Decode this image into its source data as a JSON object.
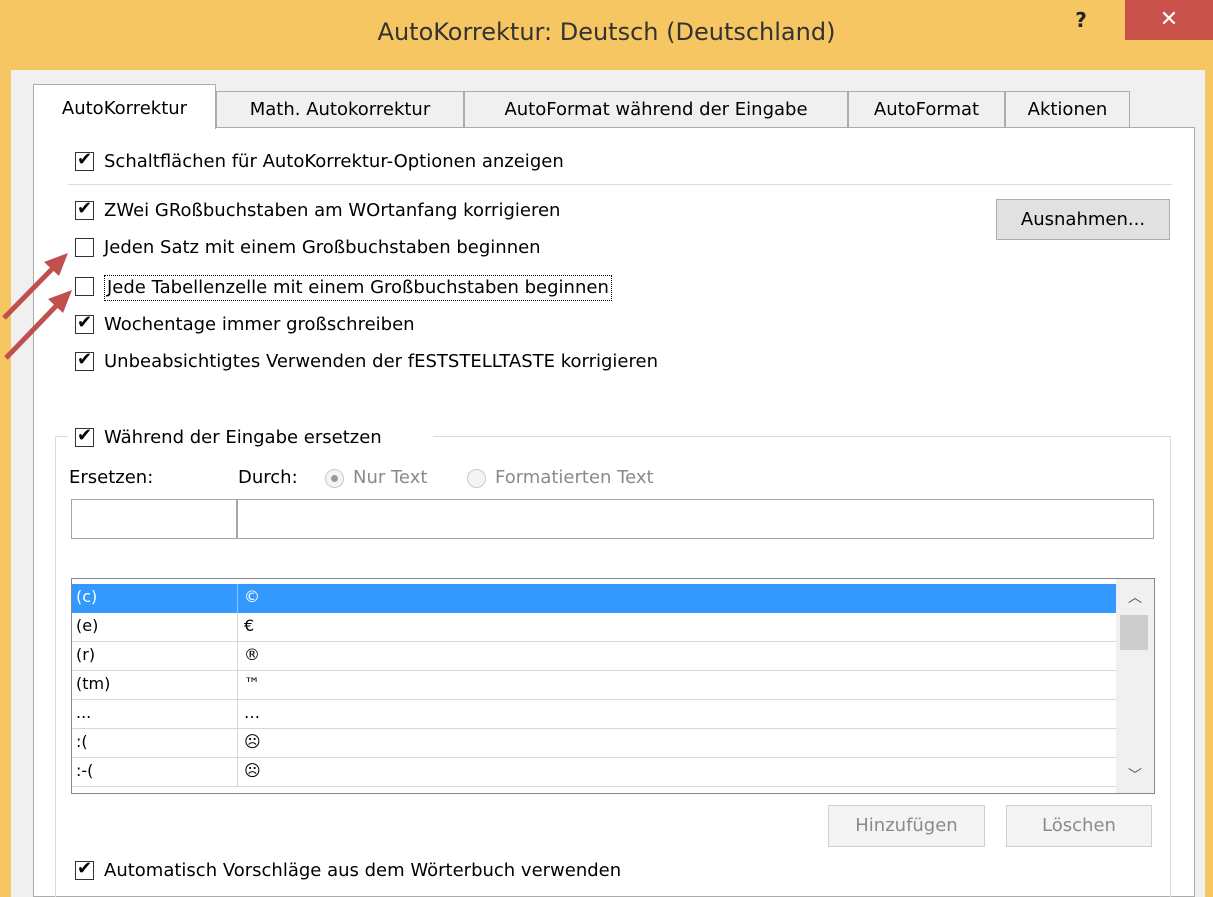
{
  "window": {
    "title": "AutoKorrektur: Deutsch (Deutschland)",
    "help_label": "?",
    "close_label": "✕"
  },
  "tabs": [
    {
      "label": "AutoKorrektur",
      "active": true
    },
    {
      "label": "Math. Autokorrektur",
      "active": false
    },
    {
      "label": "AutoFormat während der Eingabe",
      "active": false
    },
    {
      "label": "AutoFormat",
      "active": false
    },
    {
      "label": "Aktionen",
      "active": false
    }
  ],
  "options": {
    "show_buttons": {
      "checked": true,
      "label": "Schaltflächen für AutoKorrektur-Optionen anzeigen"
    },
    "two_initial_caps": {
      "checked": true,
      "label": "ZWei GRoßbuchstaben am WOrtanfang korrigieren"
    },
    "capitalize_sentences": {
      "checked": false,
      "label": "Jeden Satz mit einem Großbuchstaben beginnen"
    },
    "capitalize_table_cells": {
      "checked": false,
      "label": "Jede Tabellenzelle mit einem Großbuchstaben beginnen"
    },
    "capitalize_weekdays": {
      "checked": true,
      "label": "Wochentage immer großschreiben"
    },
    "caps_lock_fix": {
      "checked": true,
      "label": "Unbeabsichtigtes Verwenden der fESTSTELLTASTE korrigieren"
    }
  },
  "exceptions_button": "Ausnahmen...",
  "replace_group": {
    "checked": true,
    "label": "Während der Eingabe ersetzen",
    "replace_label": "Ersetzen:",
    "with_label": "Durch:",
    "radio_plain": {
      "label": "Nur Text",
      "selected": true
    },
    "radio_formatted": {
      "label": "Formatierten Text",
      "selected": false
    },
    "replace_value": "",
    "with_value": ""
  },
  "entries": [
    {
      "replace": "(c)",
      "with": "©",
      "selected": true
    },
    {
      "replace": "(e)",
      "with": "€",
      "selected": false
    },
    {
      "replace": "(r)",
      "with": "®",
      "selected": false
    },
    {
      "replace": "(tm)",
      "with": "™",
      "selected": false
    },
    {
      "replace": "...",
      "with": "…",
      "selected": false
    },
    {
      "replace": ":(",
      "with": "☹",
      "selected": false
    },
    {
      "replace": ":-(",
      "with": "☹",
      "selected": false
    }
  ],
  "buttons": {
    "add": {
      "label": "Hinzufügen",
      "enabled": false
    },
    "delete": {
      "label": "Löschen",
      "enabled": false
    }
  },
  "dictionary_suggestions": {
    "checked": true,
    "label": "Automatisch Vorschläge aus dem Wörterbuch verwenden"
  },
  "annotation_color": "#c0504d"
}
